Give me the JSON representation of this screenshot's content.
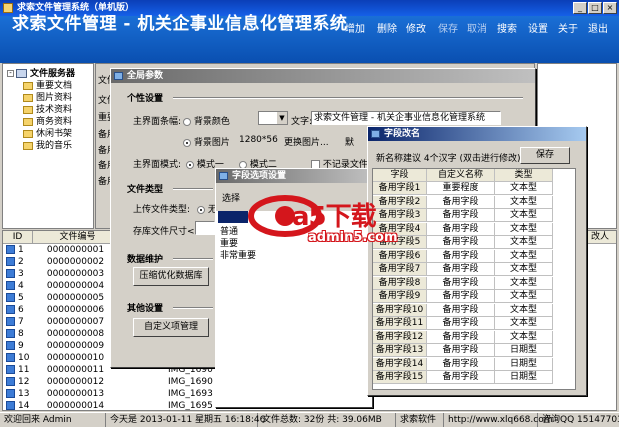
{
  "window": {
    "title": "求索文件管理系统（单机版）"
  },
  "banner": {
    "title": "求索文件管理 - 机关企事业信息化管理系统",
    "menu": [
      "增加",
      "删除",
      "修改",
      "保存",
      "取消",
      "搜索",
      "设置",
      "关于",
      "退出"
    ]
  },
  "tree": {
    "root": "文件服务器",
    "items": [
      "重要文档",
      "图片资料",
      "技术资料",
      "商务资料",
      "休闲书架",
      "我的音乐"
    ]
  },
  "main_fields": [
    "文件",
    "文件",
    "重要",
    "备用",
    "备用",
    "备用",
    "备用"
  ],
  "grid": {
    "headers": [
      "ID",
      "文件编号",
      "改人"
    ],
    "rows": [
      {
        "id": "1",
        "code": "0000000001",
        "name": ""
      },
      {
        "id": "2",
        "code": "0000000002",
        "name": ""
      },
      {
        "id": "3",
        "code": "0000000003",
        "name": ""
      },
      {
        "id": "4",
        "code": "0000000004",
        "name": ""
      },
      {
        "id": "5",
        "code": "0000000005",
        "name": ""
      },
      {
        "id": "6",
        "code": "0000000006",
        "name": ""
      },
      {
        "id": "7",
        "code": "0000000007",
        "name": ""
      },
      {
        "id": "8",
        "code": "0000000008",
        "name": ""
      },
      {
        "id": "9",
        "code": "0000000009",
        "name": ""
      },
      {
        "id": "10",
        "code": "0000000010",
        "name": ""
      },
      {
        "id": "11",
        "code": "0000000011",
        "name": "IMG_1690"
      },
      {
        "id": "12",
        "code": "0000000012",
        "name": "IMG_1690"
      },
      {
        "id": "13",
        "code": "0000000013",
        "name": "IMG_1693"
      },
      {
        "id": "14",
        "code": "0000000014",
        "name": "IMG_1695"
      }
    ]
  },
  "params": {
    "title": "全局参数",
    "personal": "个性设置",
    "bg_label": "主界面条幅:",
    "bg_color": "背景颜色",
    "text_label": "文字:",
    "text_value": "求索文件管理 - 机关企事业信息化管理系统",
    "bg_image": "背景图片",
    "bg_size": "1280*56",
    "change_image": "更换图片...",
    "default_short": "默",
    "mode_label": "主界面模式:",
    "mode1": "模式一",
    "mode2": "模式二",
    "no_record": "不记录文件",
    "file_type": "文件类型",
    "upload_type": "上传文件类型:",
    "upload_opt": "无",
    "size_label": "存库文件尺寸<",
    "db_maint": "数据维护",
    "compact_btn": "压缩优化数据库",
    "other": "其他设置",
    "custom_btn": "自定义项管理"
  },
  "field_options": {
    "title": "字段选项设置",
    "select_label": "选择",
    "items": [
      "普通",
      "重要",
      "非常重要"
    ]
  },
  "rename": {
    "title": "字段改名",
    "hint": "新名称建议 4个汉字 (双击进行修改)",
    "save": "保存",
    "headers": [
      "字段",
      "自定义名称",
      "类型"
    ],
    "rows": [
      [
        "备用字段1",
        "重要程度",
        "文本型"
      ],
      [
        "备用字段2",
        "备用字段",
        "文本型"
      ],
      [
        "备用字段3",
        "备用字段",
        "文本型"
      ],
      [
        "备用字段4",
        "备用字段",
        "文本型"
      ],
      [
        "备用字段5",
        "备用字段",
        "文本型"
      ],
      [
        "备用字段6",
        "备用字段",
        "文本型"
      ],
      [
        "备用字段7",
        "备用字段",
        "文本型"
      ],
      [
        "备用字段8",
        "备用字段",
        "文本型"
      ],
      [
        "备用字段9",
        "备用字段",
        "文本型"
      ],
      [
        "备用字段10",
        "备用字段",
        "文本型"
      ],
      [
        "备用字段11",
        "备用字段",
        "文本型"
      ],
      [
        "备用字段12",
        "备用字段",
        "文本型"
      ],
      [
        "备用字段13",
        "备用字段",
        "日期型"
      ],
      [
        "备用字段14",
        "备用字段",
        "日期型"
      ],
      [
        "备用字段15",
        "备用字段",
        "日期型"
      ]
    ]
  },
  "watermark": {
    "brand": "a5下载",
    "url": "admin5.com"
  },
  "status": {
    "welcome": "欢迎回来 Admin",
    "today": "今天是 2013-01-11 星期五 16:18:46",
    "total": "文件总数: 32份  共: 39.06MB",
    "brand": "求索软件",
    "site": "http://www.xlq668.com",
    "contact": "咨询QQ 151477039"
  },
  "colors": {
    "title_bar": "#0b3fb8",
    "banner": "#1a6fd6",
    "dialog_title": "#0a246a",
    "watermark_red": "#d4161c"
  }
}
